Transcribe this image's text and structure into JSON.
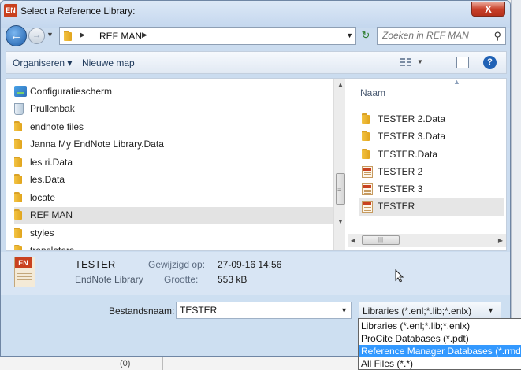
{
  "window": {
    "app_icon_text": "EN",
    "title": "Select a Reference Library:",
    "close_label": "X"
  },
  "nav": {
    "breadcrumb": "REF MAN",
    "search_placeholder": "Zoeken in REF MAN"
  },
  "toolbar": {
    "organize_label": "Organiseren ▾",
    "new_folder_label": "Nieuwe map"
  },
  "sidebar": {
    "items": [
      {
        "label": "Configuratiescherm",
        "icon": "control-panel-icon"
      },
      {
        "label": "Prullenbak",
        "icon": "recycle-bin-icon"
      },
      {
        "label": "endnote files",
        "icon": "folder-icon"
      },
      {
        "label": "Janna My EndNote Library.Data",
        "icon": "folder-icon"
      },
      {
        "label": "les ri.Data",
        "icon": "folder-icon"
      },
      {
        "label": "les.Data",
        "icon": "folder-icon"
      },
      {
        "label": "locate",
        "icon": "folder-icon"
      },
      {
        "label": "REF MAN",
        "icon": "folder-icon",
        "selected": true
      },
      {
        "label": "styles",
        "icon": "folder-icon"
      },
      {
        "label": "translators",
        "icon": "folder-icon"
      }
    ]
  },
  "files": {
    "column_header": "Naam",
    "items": [
      {
        "label": "TESTER 2.Data",
        "icon": "folder-icon"
      },
      {
        "label": "TESTER 3.Data",
        "icon": "folder-icon"
      },
      {
        "label": "TESTER.Data",
        "icon": "folder-icon"
      },
      {
        "label": "TESTER 2",
        "icon": "endnote-library-icon"
      },
      {
        "label": "TESTER 3",
        "icon": "endnote-library-icon"
      },
      {
        "label": "TESTER",
        "icon": "endnote-library-icon",
        "selected": true
      }
    ]
  },
  "details": {
    "icon_text": "EN",
    "name": "TESTER",
    "type": "EndNote Library",
    "modified_label": "Gewijzigd op:",
    "modified_value": "27-09-16 14:56",
    "size_label": "Grootte:",
    "size_value": "553 kB"
  },
  "bottom": {
    "filename_label": "Bestandsnaam:",
    "filename_value": "TESTER",
    "filter_selected": "Libraries (*.enl;*.lib;*.enlx)",
    "filter_options": [
      "Libraries (*.enl;*.lib;*.enlx)",
      "ProCite Databases (*.pdt)",
      "Reference Manager Databases (*.rmd",
      "All Files (*.*)"
    ],
    "highlighted_index": 2
  },
  "background": {
    "status_text": "(0)"
  },
  "colors": {
    "highlight": "#3399ff",
    "title_bar": "#cbdcef",
    "close_button": "#c9412b",
    "accent": "#2162b5"
  }
}
